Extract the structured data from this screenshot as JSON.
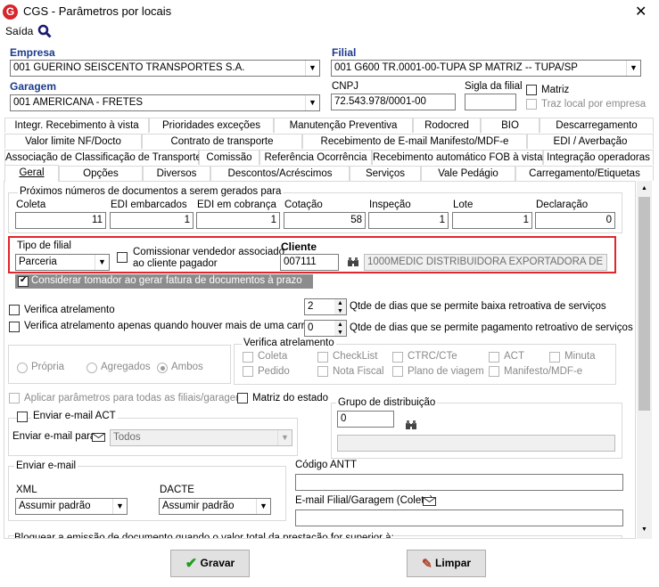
{
  "window": {
    "title": "CGS - Parâmetros por locais",
    "close": "✕"
  },
  "menu": {
    "exit": "Saída"
  },
  "empresa": {
    "label": "Empresa",
    "value": "001 GUERINO SEISCENTO TRANSPORTES S.A."
  },
  "filial": {
    "label": "Filial",
    "value": "001 G600 TR.0001-00-TUPA SP MATRIZ -- TUPA/SP"
  },
  "garagem": {
    "label": "Garagem",
    "value": "001 AMERICANA - FRETES"
  },
  "cnpj": {
    "label": "CNPJ",
    "value": "72.543.978/0001-00"
  },
  "sigla": {
    "label": "Sigla da filial",
    "value": ""
  },
  "matriz": {
    "label": "Matriz"
  },
  "traz_local": {
    "label": "Traz local por empresa"
  },
  "tabs_row1": [
    "Integr. Recebimento à vista",
    "Prioridades exceções",
    "Manutenção Preventiva",
    "Rodocred",
    "BIO",
    "Descarregamento"
  ],
  "tabs_row2": [
    "Valor limite NF/Docto",
    "Contrato de transporte",
    "Recebimento de E-mail Manifesto/MDF-e",
    "EDI / Averbação"
  ],
  "tabs_row3": [
    "Associação de Classificação de Transporte",
    "Comissão",
    "Referência Ocorrência",
    "Recebimento automático FOB à vista",
    "Integração operadoras"
  ],
  "tabs_row4": [
    "Geral",
    "Opções",
    "Diversos",
    "Descontos/Acréscimos",
    "Serviços",
    "Vale Pedágio",
    "Carregamento/Etiquetas"
  ],
  "proximos": {
    "title": "Próximos números de documentos a serem gerados para",
    "fields": [
      {
        "label": "Coleta",
        "value": "11"
      },
      {
        "label": "EDI embarcados",
        "value": "1"
      },
      {
        "label": "EDI em cobrança",
        "value": "1"
      },
      {
        "label": "Cotação",
        "value": "58"
      },
      {
        "label": "Inspeção",
        "value": "1"
      },
      {
        "label": "Lote",
        "value": "1"
      },
      {
        "label": "Declaração",
        "value": "0"
      }
    ]
  },
  "tipo_filial": {
    "label": "Tipo de filial",
    "value": "Parceria"
  },
  "comissionar": {
    "label1": "Comissionar vendedor associado",
    "label2": "ao cliente pagador"
  },
  "cliente": {
    "label": "Cliente",
    "code": "007111",
    "name": "1000MEDIC DISTRIBUIDORA EXPORTADORA DE ME"
  },
  "considerar": {
    "label": "Considerar tomador ao gerar fatura de documentos à prazo"
  },
  "verifica_atrelamento": {
    "label": "Verifica atrelamento"
  },
  "verifica_carreta": {
    "label": "Verifica atrelamento apenas quando houver mais de uma carreta"
  },
  "dias_baixa": {
    "value": "2",
    "label": "Qtde de dias que se permite baixa retroativa de serviços"
  },
  "dias_pagamento": {
    "value": "0",
    "label": "Qtde de dias que se permite pagamento retroativo de serviços"
  },
  "radios": [
    "Própria",
    "Agregados",
    "Ambos"
  ],
  "verif_group": {
    "title": "Verifica atrelamento",
    "items": [
      "Coleta",
      "CheckList",
      "CTRC/CTe",
      "ACT",
      "Minuta",
      "Pedido",
      "Nota Fiscal",
      "Plano de viagem",
      "Manifesto/MDF-e"
    ]
  },
  "aplicar": {
    "label": "Aplicar parâmetros para todas as filiais/garagens"
  },
  "matriz_estado": {
    "label": "Matriz do estado"
  },
  "grupo_dist": {
    "title": "Grupo de distribuição",
    "value": "0",
    "name": ""
  },
  "email_act": {
    "title": "Enviar e-mail ACT",
    "para_label": "Enviar e-mail para",
    "para_value": "Todos"
  },
  "enviar_email": {
    "title": "Enviar e-mail",
    "xml_label": "XML",
    "xml_value": "Assumir padrão",
    "dacte_label": "DACTE",
    "dacte_value": "Assumir padrão"
  },
  "antt": {
    "label": "Código ANTT",
    "value": ""
  },
  "email_filial": {
    "label": "E-mail Filial/Garagem (Coleta)",
    "value": ""
  },
  "bloquear": {
    "label": "Bloquear a emissão de documento quando o valor total da prestação for superior à:"
  },
  "buttons": {
    "save": "Gravar",
    "clear": "Limpar"
  },
  "colors": {
    "highlight": "#e0262b",
    "brand": "#1a3a8e"
  }
}
